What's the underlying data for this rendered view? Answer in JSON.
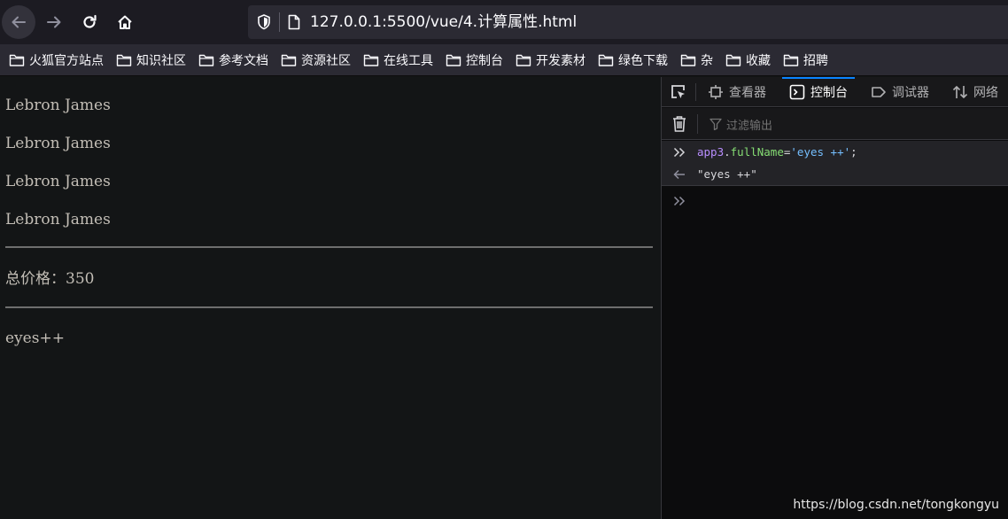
{
  "browser": {
    "url": "127.0.0.1:5500/vue/4.计算属性.html",
    "nav_icons": [
      "back-arrow-icon",
      "forward-arrow-icon",
      "reload-icon",
      "home-icon"
    ]
  },
  "bookmarks": [
    {
      "label": "火狐官方站点"
    },
    {
      "label": "知识社区"
    },
    {
      "label": "参考文档"
    },
    {
      "label": "资源社区"
    },
    {
      "label": "在线工具"
    },
    {
      "label": "控制台"
    },
    {
      "label": "开发素材"
    },
    {
      "label": "绿色下载"
    },
    {
      "label": "杂"
    },
    {
      "label": "收藏"
    },
    {
      "label": "招聘"
    }
  ],
  "page": {
    "names": [
      "Lebron James",
      "Lebron James",
      "Lebron James",
      "Lebron James"
    ],
    "price_text": "总价格：350",
    "full_name": "eyes++"
  },
  "devtools": {
    "tabs": [
      {
        "label": "查看器",
        "icon": "inspector-icon"
      },
      {
        "label": "控制台",
        "icon": "console-icon",
        "active": true
      },
      {
        "label": "调试器",
        "icon": "debugger-icon"
      },
      {
        "label": "网络",
        "icon": "network-icon"
      }
    ],
    "filter_placeholder": "过滤输出",
    "console": {
      "input": {
        "var": "app3",
        "dot": ".",
        "prop": "fullName",
        "eq": "=",
        "str": "'eyes ++'",
        "semi": ";"
      },
      "output": "\"eyes ++\""
    },
    "accent_color": "#0a84ff"
  },
  "watermark": "https://blog.csdn.net/tongkongyu"
}
